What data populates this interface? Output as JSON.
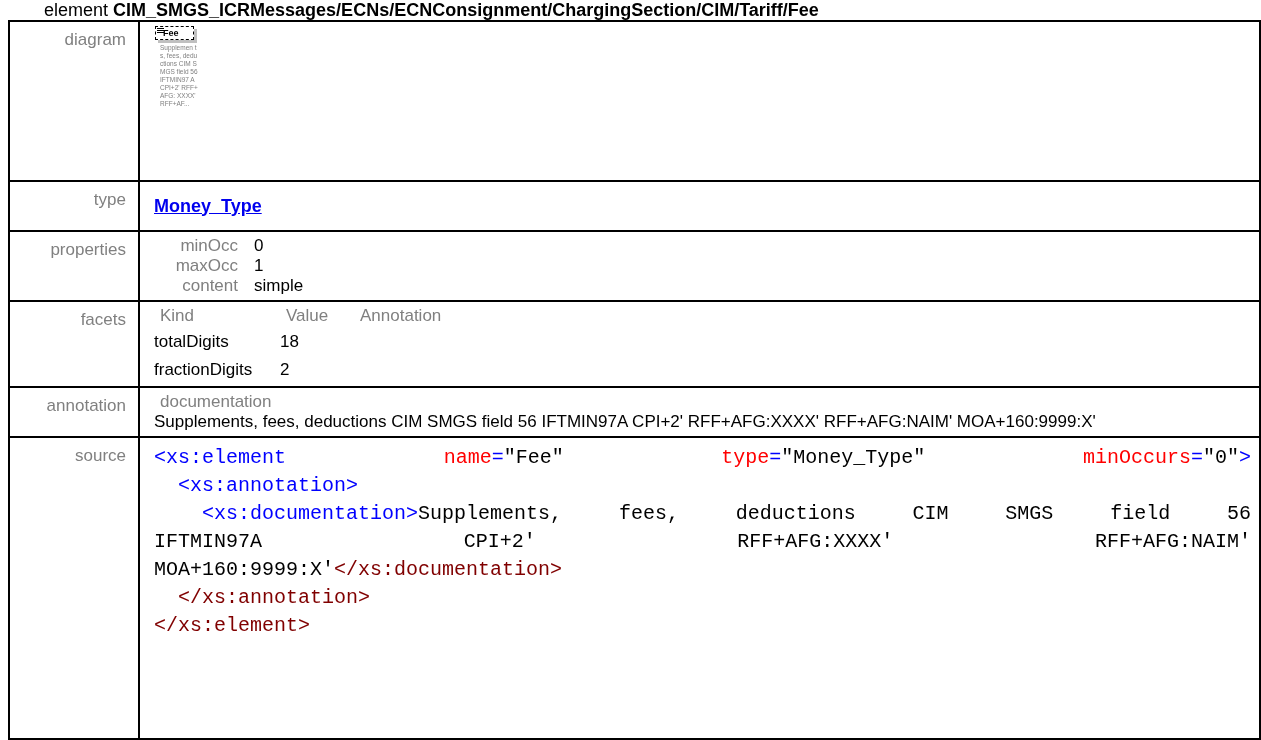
{
  "heading": "element **CIM_SMGS_ICRMessages/ECNs/ECNConsignment/ChargingSection/CIM/Tariff/Fee**",
  "rows": [
    {
      "kind": "diagram",
      "label": "diagram",
      "node": "Fee",
      "note": "Supplemen ts, fees, deductions CIM SMGS field 56 IFTMIN97 A CPI+2' RFF+AFG: XXXX' RFF+AF..."
    },
    {
      "kind": "type",
      "label": "type",
      "link": "Money_Type"
    },
    {
      "kind": "properties",
      "label": "properties",
      "items": [
        {
          "name": "minOcc",
          "value": "0"
        },
        {
          "name": "maxOcc",
          "value": "1"
        },
        {
          "name": "content",
          "value": "simple"
        }
      ]
    },
    {
      "kind": "facets",
      "label": "facets",
      "columns": [
        "Kind",
        "Value",
        "Annotation"
      ],
      "items": [
        {
          "kind": "totalDigits",
          "value": "18"
        },
        {
          "kind": "fractionDigits",
          "value": "2"
        }
      ]
    },
    {
      "kind": "annotation",
      "label": "annotation",
      "title": "documentation",
      "text": "Supplements, fees, deductions CIM SMGS field 56 IFTMIN97A CPI+2' RFF+AFG:XXXX' RFF+AFG:NAIM' MOA+160:9999:X'"
    },
    {
      "kind": "source",
      "label": "source",
      "lines": [
        {
          "kind": "justified",
          "words": [
            [
              {
                "kind": "tag",
                "text": "<xs:element"
              }
            ],
            [
              {
                "kind": "attr",
                "text": "name"
              },
              {
                "kind": "tag",
                "text": "="
              },
              {
                "kind": "value",
                "text": "\"Fee\""
              }
            ],
            [
              {
                "kind": "attr",
                "text": "type"
              },
              {
                "kind": "tag",
                "text": "="
              },
              {
                "kind": "value",
                "text": "\"Money_Type\""
              }
            ],
            [
              {
                "kind": "attr",
                "text": "minOccurs"
              },
              {
                "kind": "tag",
                "text": "="
              },
              {
                "kind": "value",
                "text": "\"0\""
              },
              {
                "kind": "tag",
                "text": ">"
              }
            ]
          ]
        },
        {
          "kind": "plain",
          "words": [
            [
              {
                "kind": "tag",
                "text": "  <xs:annotation>"
              }
            ]
          ]
        },
        {
          "kind": "justified",
          "words": [
            [
              {
                "kind": "tag",
                "text": "    <xs:documentation>"
              },
              {
                "kind": "value",
                "text": "Supplements,"
              }
            ],
            [
              {
                "kind": "value",
                "text": "fees,"
              }
            ],
            [
              {
                "kind": "value",
                "text": "deductions"
              }
            ],
            [
              {
                "kind": "value",
                "text": "CIM"
              }
            ],
            [
              {
                "kind": "value",
                "text": "SMGS"
              }
            ],
            [
              {
                "kind": "value",
                "text": "field"
              }
            ],
            [
              {
                "kind": "value",
                "text": "56"
              }
            ]
          ]
        },
        {
          "kind": "justified",
          "words": [
            [
              {
                "kind": "value",
                "text": "IFTMIN97A"
              }
            ],
            [
              {
                "kind": "value",
                "text": "CPI+2'"
              }
            ],
            [
              {
                "kind": "value",
                "text": "RFF+AFG:XXXX'"
              }
            ],
            [
              {
                "kind": "value",
                "text": "RFF+AFG:NAIM'"
              }
            ]
          ]
        },
        {
          "kind": "plain",
          "words": [
            [
              {
                "kind": "value",
                "text": "MOA+160:9999:X'"
              },
              {
                "kind": "end-tag",
                "text": "</xs:documentation>"
              }
            ]
          ]
        },
        {
          "kind": "plain",
          "words": [
            [
              {
                "kind": "end-tag",
                "text": "  </xs:annotation>"
              }
            ]
          ]
        },
        {
          "kind": "plain",
          "words": [
            [
              {
                "kind": "end-tag",
                "text": "</xs:element>"
              }
            ]
          ]
        }
      ]
    }
  ]
}
